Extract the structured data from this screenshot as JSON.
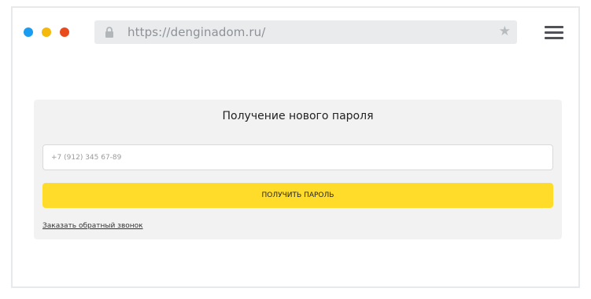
{
  "browser": {
    "url": "https://denginadom.ru/",
    "icons": {
      "lock": "lock-icon",
      "bookmark": "star-icon",
      "menu": "hamburger-menu-icon"
    },
    "window_dots": [
      "#1a9df0",
      "#f4b90b",
      "#ea4b1c"
    ]
  },
  "form": {
    "title": "Получение нового пароля",
    "phone_placeholder": "+7 (912) 345 67-89",
    "submit_label": "ПОЛУЧИТЬ ПАРОЛЬ",
    "callback_link": "Заказать обратный звонок"
  },
  "colors": {
    "accent": "#ffdc2a",
    "card_background": "#f2f2f2"
  }
}
